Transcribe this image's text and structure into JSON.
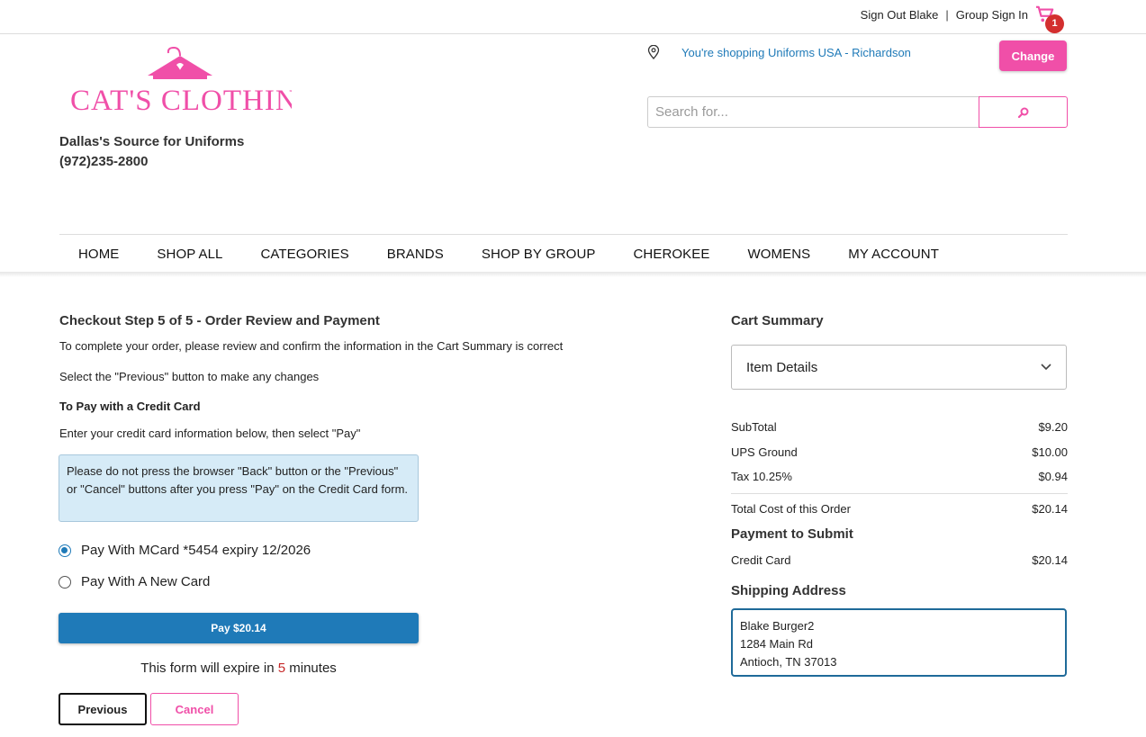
{
  "topbar": {
    "sign_out": "Sign Out Blake",
    "separator": "|",
    "group_sign_in": "Group Sign In",
    "cart_count": "1",
    "cart_icon": "cart-icon"
  },
  "header": {
    "logo_text": "CAT'S CLOTHING",
    "tagline_line1": "Dallas's Source for Uniforms",
    "tagline_line2": "(972)235-2800",
    "store_text": "You're shopping Uniforms USA - Richardson",
    "change_label": "Change",
    "search_placeholder": "Search for...",
    "brand_color": "#f04fa8"
  },
  "nav": {
    "items": [
      "HOME",
      "SHOP ALL",
      "CATEGORIES",
      "BRANDS",
      "SHOP BY GROUP",
      "CHEROKEE",
      "WOMENS",
      "MY ACCOUNT"
    ]
  },
  "checkout": {
    "title": "Checkout Step 5 of 5 - Order Review and Payment",
    "intro": "To complete your order, please review and confirm the information in the Cart Summary is correct",
    "previous_note": "Select the \"Previous\" button to make any changes",
    "credit_heading": "To Pay with a Credit Card",
    "credit_instructions": "Enter your credit card information below, then select \"Pay\"",
    "notice": "Please do not press the browser \"Back\" button or the \"Previous\" or \"Cancel\" buttons after you press \"Pay\" on the Credit Card form.",
    "option_saved": "Pay With MCard *5454 expiry 12/2026",
    "option_new": "Pay With A New Card",
    "pay_label": "Pay $20.14",
    "expire_prefix": "This form will expire in ",
    "expire_minutes": "5",
    "expire_suffix": " minutes",
    "previous_label": "Previous",
    "cancel_label": "Cancel"
  },
  "summary": {
    "title": "Cart Summary",
    "item_details": "Item Details",
    "subtotal_label": "SubTotal",
    "subtotal_value": "$9.20",
    "shipping_label": "UPS Ground",
    "shipping_value": "$10.00",
    "tax_label": "Tax 10.25%",
    "tax_value": "$0.94",
    "total_label": "Total Cost of this Order",
    "total_value": "$20.14",
    "payment_title": "Payment to Submit",
    "payment_label": "Credit Card",
    "payment_value": "$20.14",
    "shipping_title": "Shipping Address",
    "address_line1": "Blake Burger2",
    "address_line2": "1284 Main Rd",
    "address_line3": "Antioch, TN 37013"
  }
}
